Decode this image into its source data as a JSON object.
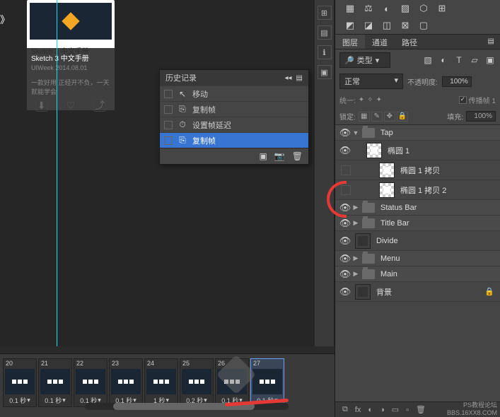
{
  "card": {
    "strip": "Sketch 3 中文手册",
    "title": "Sketch 3 中文手册",
    "subtitle": "UIWeek  2014.08.01",
    "desc": "一款好用  正经开不负，一天\n就能学会"
  },
  "history": {
    "title": "历史记录",
    "items": [
      {
        "icon": "↖",
        "label": "移动"
      },
      {
        "icon": "⎘",
        "label": "复制帧"
      },
      {
        "icon": "⏱",
        "label": "设置帧延迟"
      },
      {
        "icon": "⎘",
        "label": "复制帧"
      }
    ]
  },
  "panels": {
    "tabs": [
      "图层",
      "通道",
      "路径"
    ],
    "filter": "类型",
    "blend_mode": "正常",
    "opacity_label": "不透明度:",
    "opacity_value": "100%",
    "unify_label": "统一:",
    "propagate": "传播帧 1",
    "lock_label": "锁定:",
    "fill_label": "填充:",
    "fill_value": "100%"
  },
  "layers": [
    {
      "type": "group",
      "name": "Tap",
      "eye": true,
      "expanded": true,
      "indent": 0
    },
    {
      "type": "shape",
      "name": "椭圆 1",
      "eye": true,
      "indent": 1,
      "thumb": "ellipse"
    },
    {
      "type": "shape",
      "name": "椭圆 1 拷贝",
      "eye": false,
      "indent": 2,
      "thumb": "ellipse"
    },
    {
      "type": "shape",
      "name": "椭圆 1 拷贝 2",
      "eye": false,
      "indent": 2,
      "thumb": "ellipse"
    },
    {
      "type": "group",
      "name": "Status Bar",
      "eye": true,
      "indent": 0
    },
    {
      "type": "group",
      "name": "Title Bar",
      "eye": true,
      "indent": 0
    },
    {
      "type": "layer",
      "name": "Divide",
      "eye": true,
      "indent": 0,
      "thumb": "solid"
    },
    {
      "type": "group",
      "name": "Menu",
      "eye": true,
      "indent": 0
    },
    {
      "type": "group",
      "name": "Main",
      "eye": true,
      "indent": 0
    },
    {
      "type": "bg",
      "name": "背景",
      "eye": true,
      "indent": 0,
      "locked": true,
      "thumb": "solid"
    }
  ],
  "timeline": {
    "frames": [
      {
        "num": "20",
        "delay": "0.1 秒"
      },
      {
        "num": "21",
        "delay": "0.1 秒"
      },
      {
        "num": "22",
        "delay": "0.1 秒"
      },
      {
        "num": "23",
        "delay": "0.1 秒"
      },
      {
        "num": "24",
        "delay": "1 秒"
      },
      {
        "num": "25",
        "delay": "0.2 秒"
      },
      {
        "num": "26",
        "delay": "0.1 秒"
      },
      {
        "num": "27",
        "delay": "0.1 秒"
      }
    ],
    "left_delay": "秒"
  },
  "watermark": {
    "line1": "PS教程论坛",
    "line2": "BBS.16XX8.COM"
  }
}
